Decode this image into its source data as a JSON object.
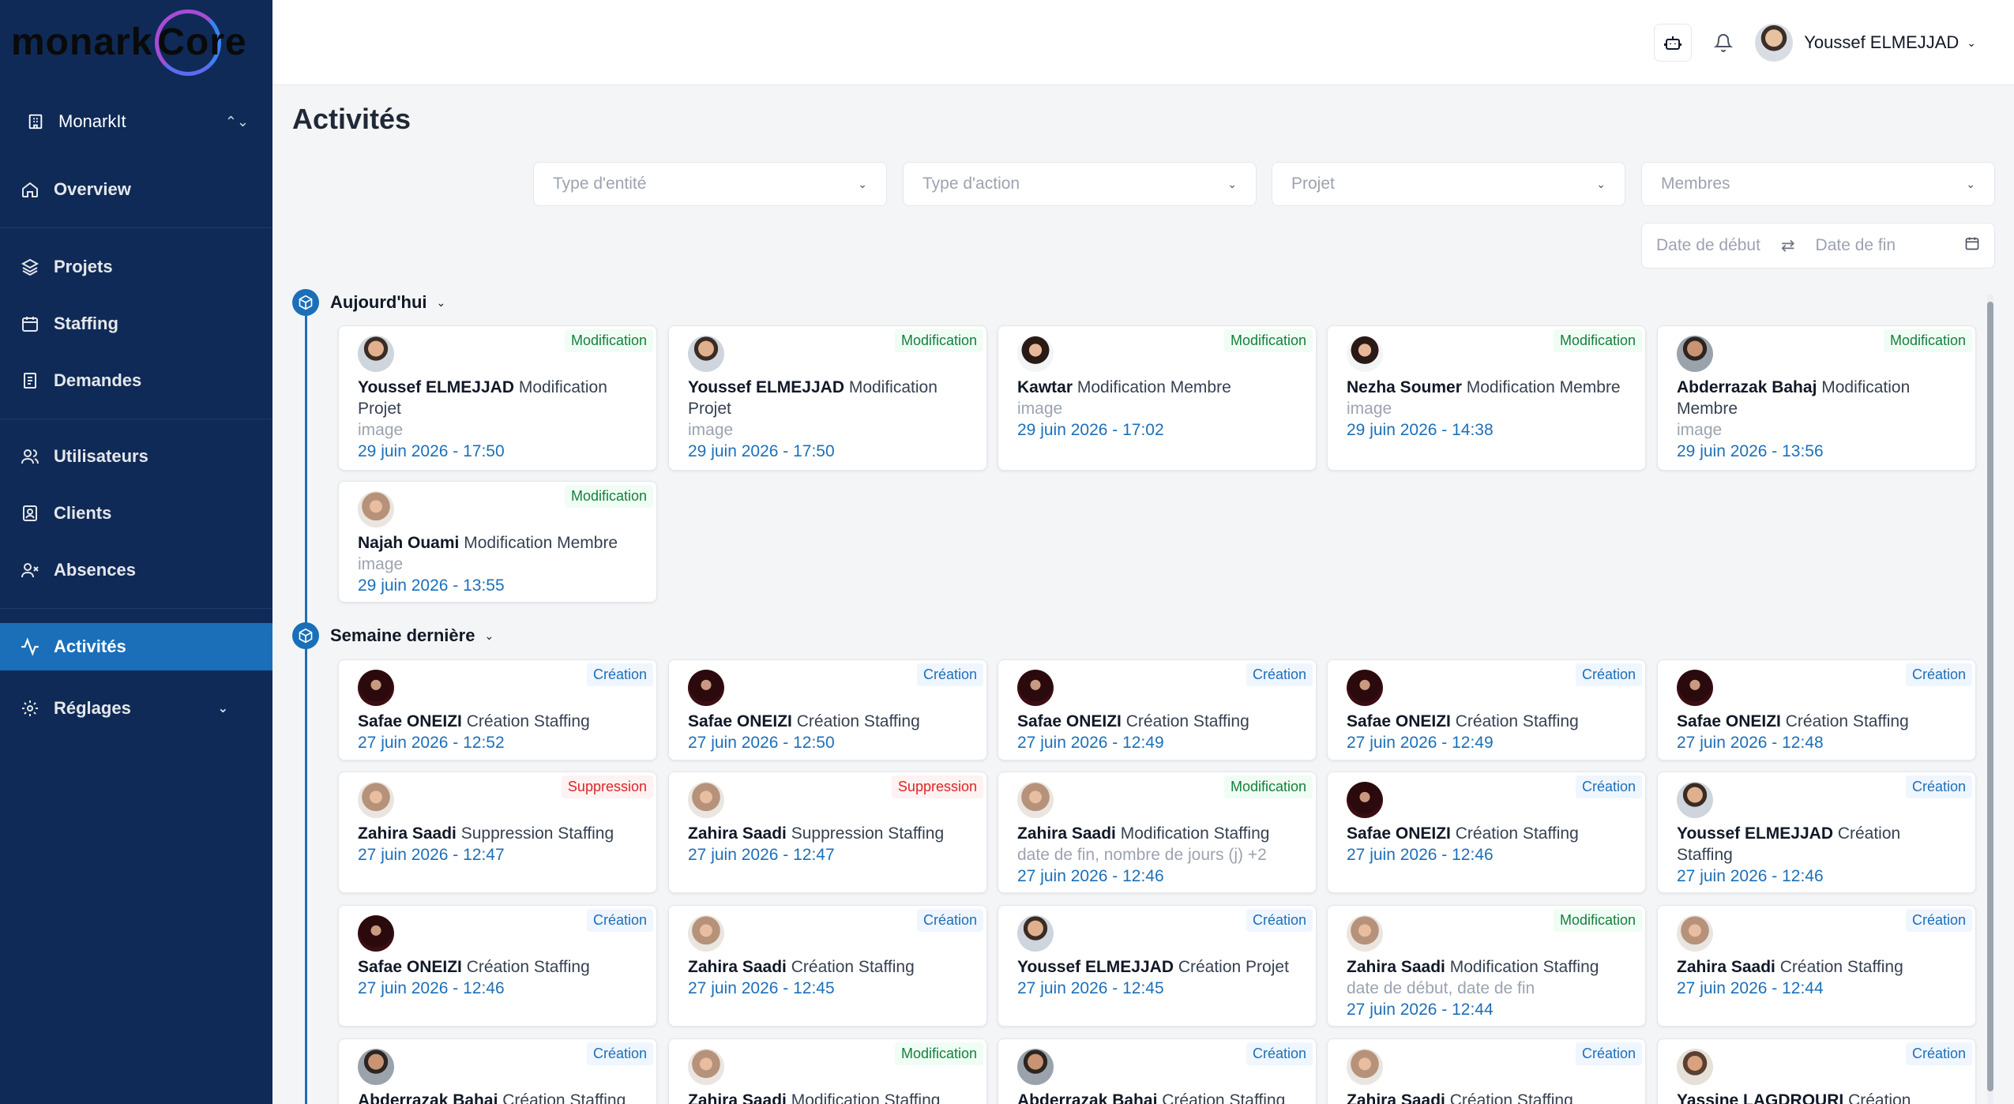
{
  "brand": {
    "logo_text": "monark",
    "logo_text2": "Core"
  },
  "sidebar": {
    "org_name": "MonarkIt",
    "items": [
      {
        "label": "Overview",
        "icon": "home-icon"
      },
      {
        "label": "Projets",
        "icon": "layers-icon"
      },
      {
        "label": "Staffing",
        "icon": "calendar-icon"
      },
      {
        "label": "Demandes",
        "icon": "document-icon"
      },
      {
        "label": "Utilisateurs",
        "icon": "users-icon"
      },
      {
        "label": "Clients",
        "icon": "contact-icon"
      },
      {
        "label": "Absences",
        "icon": "user-x-icon"
      },
      {
        "label": "Activités",
        "icon": "activity-icon"
      },
      {
        "label": "Réglages",
        "icon": "settings-icon"
      }
    ],
    "active": "Activités"
  },
  "topbar": {
    "user_name": "Youssef ELMEJJAD"
  },
  "page": {
    "title": "Activités"
  },
  "filters": {
    "entity_type": "Type d'entité",
    "action_type": "Type d'action",
    "project": "Projet",
    "members": "Membres",
    "start_date": "Date de début",
    "end_date": "Date de fin"
  },
  "sections": [
    {
      "label": "Aujourd'hui",
      "cards": [
        {
          "badge": "Modification",
          "badge_type": "mod",
          "avatar": "av-man",
          "name": "Youssef ELMEJJAD",
          "action": "Modification Projet",
          "detail": "image",
          "date": "29 juin 2026 - 17:50"
        },
        {
          "badge": "Modification",
          "badge_type": "mod",
          "avatar": "av-man",
          "name": "Youssef ELMEJJAD",
          "action": "Modification Projet",
          "detail": "image",
          "date": "29 juin 2026 - 17:50"
        },
        {
          "badge": "Modification",
          "badge_type": "mod",
          "avatar": "av-woman",
          "name": "Kawtar",
          "action": "Modification Membre",
          "detail": "image",
          "date": "29 juin 2026 - 17:02"
        },
        {
          "badge": "Modification",
          "badge_type": "mod",
          "avatar": "av-woman",
          "name": "Nezha Soumer",
          "action": "Modification Membre",
          "detail": "image",
          "date": "29 juin 2026 - 14:38"
        },
        {
          "badge": "Modification",
          "badge_type": "mod",
          "avatar": "av-abd",
          "name": "Abderrazak Bahaj",
          "action": "Modification Membre",
          "detail": "image",
          "date": "29 juin 2026 - 13:56"
        },
        {
          "badge": "Modification",
          "badge_type": "mod",
          "avatar": "av-scarf",
          "name": "Najah Ouami",
          "action": "Modification Membre",
          "detail": "image",
          "date": "29 juin 2026 - 13:55"
        }
      ]
    },
    {
      "label": "Semaine dernière",
      "cards": [
        {
          "badge": "Création",
          "badge_type": "cre",
          "avatar": "av-safae",
          "name": "Safae ONEIZI",
          "action": "Création Staffing",
          "detail": "",
          "date": "27 juin 2026 - 12:52"
        },
        {
          "badge": "Création",
          "badge_type": "cre",
          "avatar": "av-safae",
          "name": "Safae ONEIZI",
          "action": "Création Staffing",
          "detail": "",
          "date": "27 juin 2026 - 12:50"
        },
        {
          "badge": "Création",
          "badge_type": "cre",
          "avatar": "av-safae",
          "name": "Safae ONEIZI",
          "action": "Création Staffing",
          "detail": "",
          "date": "27 juin 2026 - 12:49"
        },
        {
          "badge": "Création",
          "badge_type": "cre",
          "avatar": "av-safae",
          "name": "Safae ONEIZI",
          "action": "Création Staffing",
          "detail": "",
          "date": "27 juin 2026 - 12:49"
        },
        {
          "badge": "Création",
          "badge_type": "cre",
          "avatar": "av-safae",
          "name": "Safae ONEIZI",
          "action": "Création Staffing",
          "detail": "",
          "date": "27 juin 2026 - 12:48"
        },
        {
          "badge": "Suppression",
          "badge_type": "sup",
          "avatar": "av-scarf",
          "name": "Zahira Saadi",
          "action": "Suppression Staffing",
          "detail": "",
          "date": "27 juin 2026 - 12:47"
        },
        {
          "badge": "Suppression",
          "badge_type": "sup",
          "avatar": "av-scarf",
          "name": "Zahira Saadi",
          "action": "Suppression Staffing",
          "detail": "",
          "date": "27 juin 2026 - 12:47"
        },
        {
          "badge": "Modification",
          "badge_type": "mod",
          "avatar": "av-scarf",
          "name": "Zahira Saadi",
          "action": "Modification Staffing",
          "detail": "date de fin, nombre de jours (j) +2",
          "date": "27 juin 2026 - 12:46"
        },
        {
          "badge": "Création",
          "badge_type": "cre",
          "avatar": "av-safae",
          "name": "Safae ONEIZI",
          "action": "Création Staffing",
          "detail": "",
          "date": "27 juin 2026 - 12:46"
        },
        {
          "badge": "Création",
          "badge_type": "cre",
          "avatar": "av-man",
          "name": "Youssef ELMEJJAD",
          "action": "Création Staffing",
          "detail": "",
          "date": "27 juin 2026 - 12:46"
        },
        {
          "badge": "Création",
          "badge_type": "cre",
          "avatar": "av-safae",
          "name": "Safae ONEIZI",
          "action": "Création Staffing",
          "detail": "",
          "date": "27 juin 2026 - 12:46"
        },
        {
          "badge": "Création",
          "badge_type": "cre",
          "avatar": "av-scarf",
          "name": "Zahira Saadi",
          "action": "Création Staffing",
          "detail": "",
          "date": "27 juin 2026 - 12:45"
        },
        {
          "badge": "Création",
          "badge_type": "cre",
          "avatar": "av-man",
          "name": "Youssef ELMEJJAD",
          "action": "Création Projet",
          "detail": "",
          "date": "27 juin 2026 - 12:45"
        },
        {
          "badge": "Modification",
          "badge_type": "mod",
          "avatar": "av-scarf",
          "name": "Zahira Saadi",
          "action": "Modification Staffing",
          "detail": "date de début, date de fin",
          "date": "27 juin 2026 - 12:44"
        },
        {
          "badge": "Création",
          "badge_type": "cre",
          "avatar": "av-scarf",
          "name": "Zahira Saadi",
          "action": "Création Staffing",
          "detail": "",
          "date": "27 juin 2026 - 12:44"
        },
        {
          "badge": "Création",
          "badge_type": "cre",
          "avatar": "av-abd",
          "name": "Abderrazak Bahaj",
          "action": "Création Staffing",
          "detail": "",
          "date": ""
        },
        {
          "badge": "Modification",
          "badge_type": "mod",
          "avatar": "av-scarf",
          "name": "Zahira Saadi",
          "action": "Modification Staffing",
          "detail": "",
          "date": ""
        },
        {
          "badge": "Création",
          "badge_type": "cre",
          "avatar": "av-abd",
          "name": "Abderrazak Bahaj",
          "action": "Création Staffing",
          "detail": "",
          "date": ""
        },
        {
          "badge": "Création",
          "badge_type": "cre",
          "avatar": "av-scarf",
          "name": "Zahira Saadi",
          "action": "Création Staffing",
          "detail": "",
          "date": ""
        },
        {
          "badge": "Création",
          "badge_type": "cre",
          "avatar": "av-yas",
          "name": "Yassine LAGDROURI",
          "action": "Création",
          "detail": "",
          "date": ""
        }
      ]
    }
  ]
}
